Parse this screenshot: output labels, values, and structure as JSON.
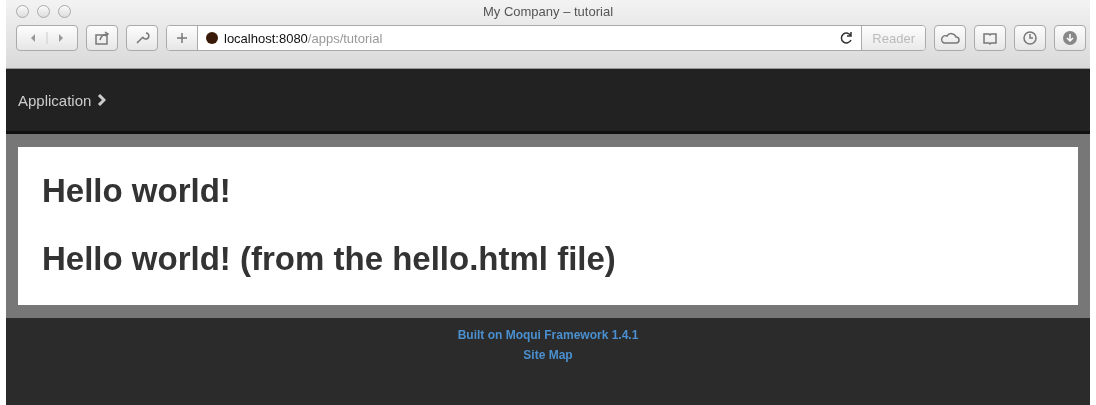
{
  "window": {
    "title": "My Company – tutorial"
  },
  "toolbar": {
    "url": {
      "host": "localhost:8080",
      "path": "/apps/tutorial"
    },
    "reader": {
      "label": "Reader",
      "disabled": true
    }
  },
  "nav": {
    "breadcrumb": "Application"
  },
  "content": {
    "headings": [
      "Hello world!",
      "Hello world! (from the hello.html file)"
    ]
  },
  "footer": {
    "links": [
      "Built on Moqui Framework 1.4.1",
      "Site Map"
    ]
  }
}
